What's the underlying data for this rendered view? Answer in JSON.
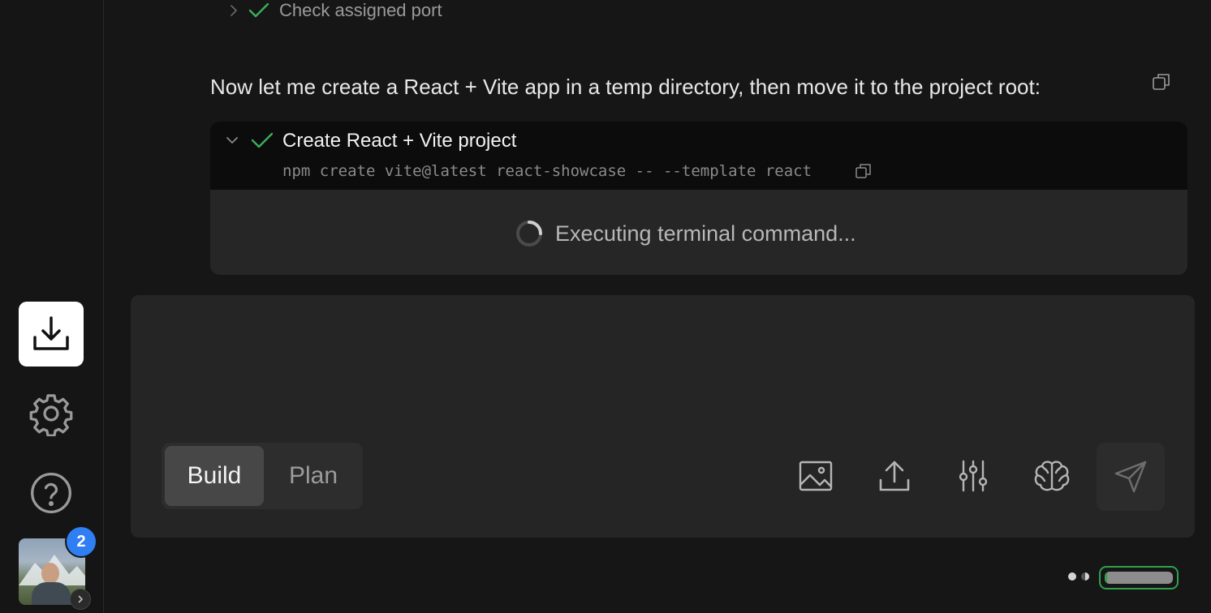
{
  "sidebar": {
    "icons": [
      "download-icon",
      "gear-icon",
      "help-icon"
    ],
    "notification_count": "2"
  },
  "chat": {
    "step_label": "Check assigned port",
    "message": "Now let me create a React + Vite app in a temp directory, then move it to the project root:",
    "command_card": {
      "title": "Create React + Vite project",
      "command": "npm create vite@latest react-showcase -- --template react",
      "status": "Executing terminal command..."
    }
  },
  "composer": {
    "modes": [
      "Build",
      "Plan"
    ],
    "active_mode": "Build",
    "tools": [
      "image-icon",
      "upload-icon",
      "sliders-icon",
      "brain-icon"
    ],
    "send_icon": "send-icon"
  },
  "status": {
    "progress": 0.03,
    "accent": "#2fa24a"
  }
}
